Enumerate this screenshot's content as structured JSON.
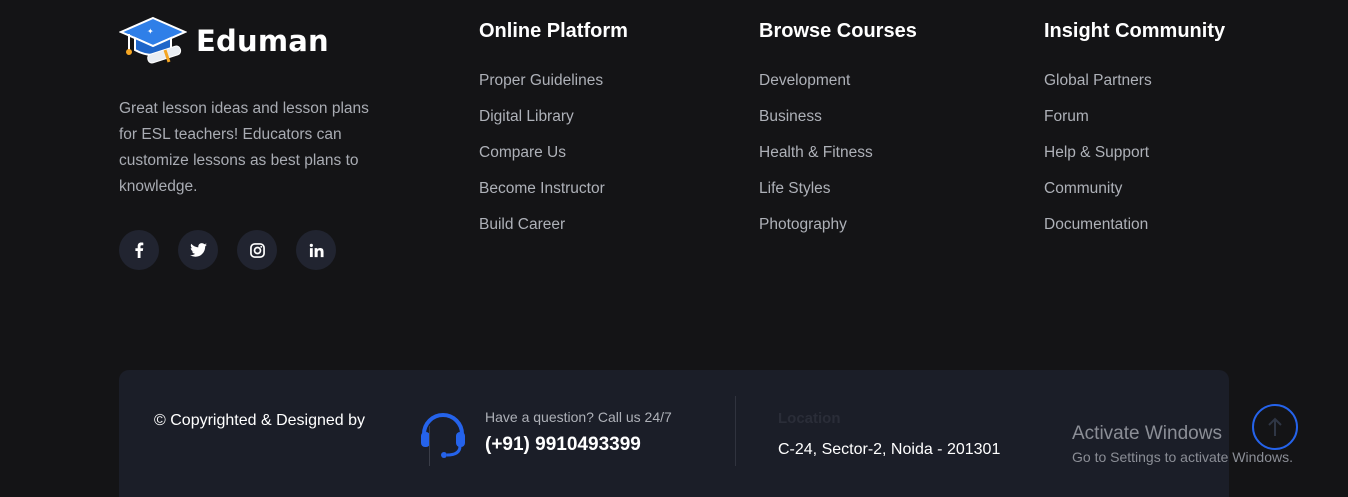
{
  "brand": {
    "name": "Eduman",
    "about": "Great lesson ideas and lesson plans for ESL teachers! Educators can customize lessons as best plans to knowledge."
  },
  "socials": [
    {
      "icon": "facebook-icon",
      "glyph": "f"
    },
    {
      "icon": "twitter-icon",
      "glyph": "t"
    },
    {
      "icon": "instagram-icon",
      "glyph": "ig"
    },
    {
      "icon": "linkedin-icon",
      "glyph": "in"
    }
  ],
  "columns": [
    {
      "title": "Online Platform",
      "links": [
        "Proper Guidelines",
        "Digital Library",
        "Compare Us",
        "Become Instructor",
        "Build Career"
      ]
    },
    {
      "title": "Browse Courses",
      "links": [
        "Development",
        "Business",
        "Health & Fitness",
        "Life Styles",
        "Photography"
      ]
    },
    {
      "title": "Insight Community",
      "links": [
        "Global Partners",
        "Forum",
        "Help & Support",
        "Community",
        "Documentation"
      ]
    }
  ],
  "bottom": {
    "copyright": "© Copyrighted & Designed by",
    "question": "Have a question? Call us 24/7",
    "phone": "(+91) 9910493399",
    "location_label": "Location",
    "location": "C-24, Sector-2, Noida - 201301"
  },
  "watermark": {
    "title": "Activate Windows",
    "subtitle": "Go to Settings to activate Windows."
  },
  "colors": {
    "background": "#141416",
    "panel": "#1b1e28",
    "accent": "#2563eb"
  }
}
